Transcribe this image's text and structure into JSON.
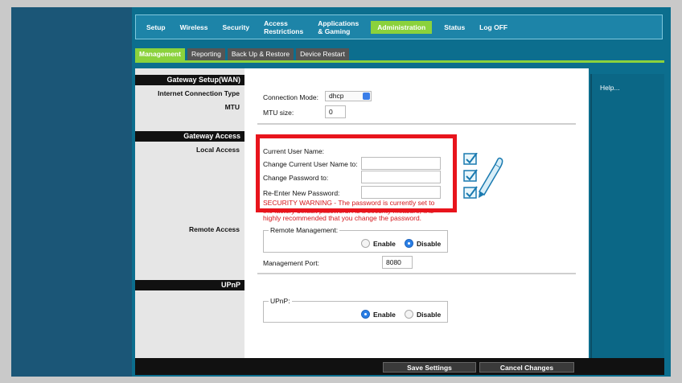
{
  "nav": {
    "setup": "Setup",
    "wireless": "Wireless",
    "security": "Security",
    "access_1": "Access",
    "access_2": "Restrictions",
    "apps_1": "Applications",
    "apps_2": "& Gaming",
    "administration": "Administration",
    "status": "Status",
    "logoff": "Log OFF"
  },
  "subtabs": {
    "management": "Management",
    "reporting": "Reporting",
    "backup": "Back Up & Restore",
    "restart": "Device Restart"
  },
  "left": {
    "gateway_setup": "Gateway Setup(WAN)",
    "internet_connection_type": "Internet Connection Type",
    "mtu": "MTU",
    "gateway_access": "Gateway Access",
    "local_access": "Local Access",
    "remote_access": "Remote Access",
    "upnp": "UPnP"
  },
  "form": {
    "connection_mode_label": "Connection Mode:",
    "connection_mode_value": "dhcp",
    "mtu_size_label": "MTU size:",
    "mtu_size_value": "0",
    "current_user_label": "Current User Name:",
    "change_user_label": "Change Current User Name to:",
    "change_password_label": "Change Password to:",
    "reenter_password_label": "Re-Enter New Password:",
    "warning": "SECURITY WARNING - The password is currently set to the factory default password. As a security measure, it is highly recommended that you change the password.",
    "remote_mgmt_legend": "Remote Management:",
    "enable": "Enable",
    "disable": "Disable",
    "mgmt_port_label": "Management Port:",
    "mgmt_port_value": "8080",
    "upnp_legend": "UPnP:"
  },
  "help": "Help...",
  "buttons": {
    "save": "Save Settings",
    "cancel": "Cancel Changes"
  },
  "colors": {
    "accent_green": "#8bd23c",
    "frame_blue": "#0c6e8e",
    "highlight_red": "#e8141c"
  }
}
